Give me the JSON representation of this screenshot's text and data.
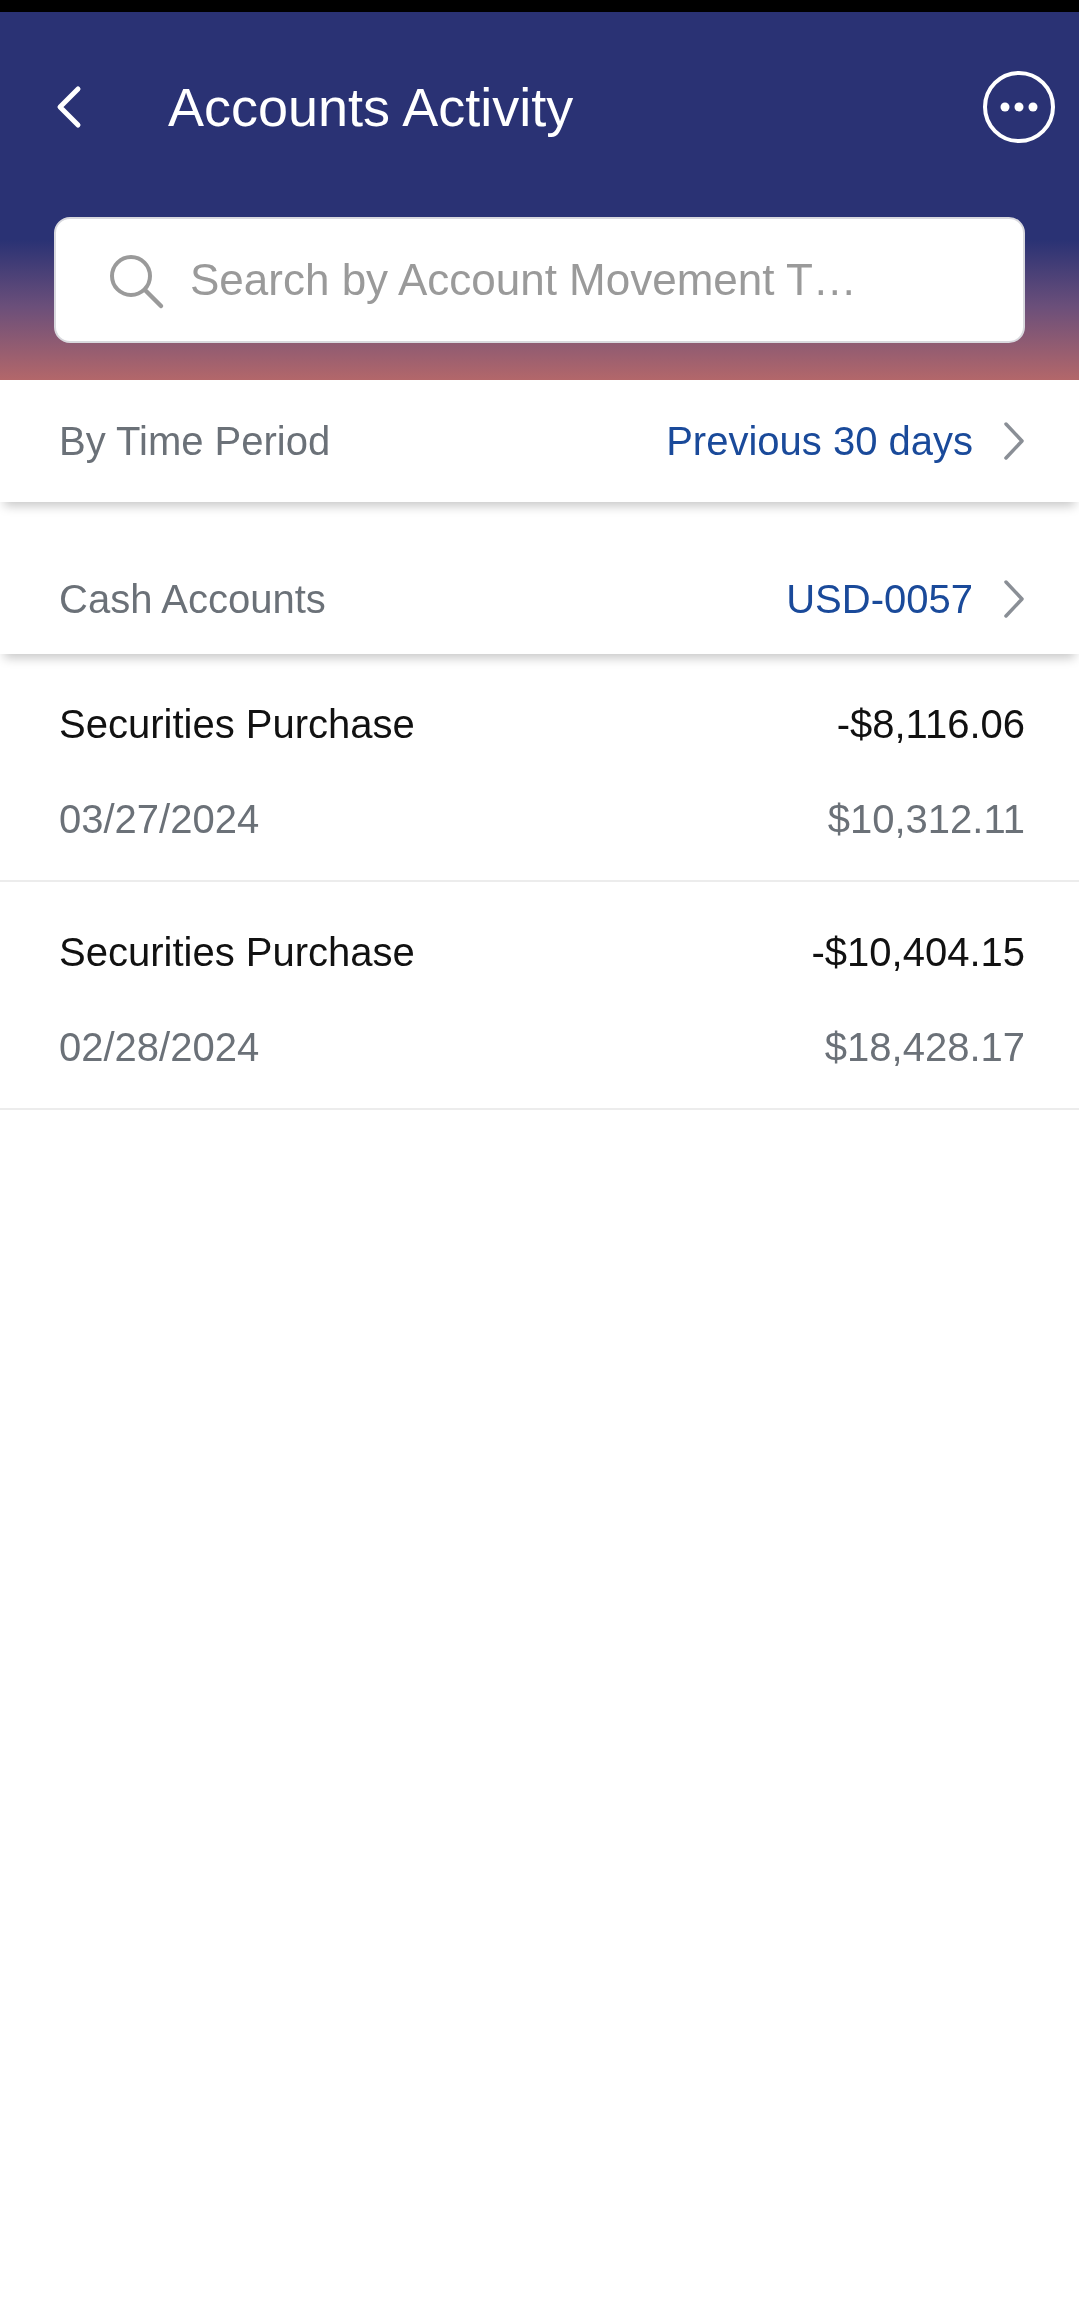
{
  "header": {
    "title": "Accounts Activity"
  },
  "search": {
    "placeholder": "Search by Account Movement T…"
  },
  "filters": [
    {
      "label": "By Time Period",
      "value": "Previous 30 days"
    },
    {
      "label": "Cash Accounts",
      "value": "USD-0057"
    }
  ],
  "transactions": [
    {
      "description": "Securities Purchase",
      "amount": "-$8,116.06",
      "date": "03/27/2024",
      "balance": "$10,312.11"
    },
    {
      "description": "Securities Purchase",
      "amount": "-$10,404.15",
      "date": "02/28/2024",
      "balance": "$18,428.17"
    }
  ]
}
